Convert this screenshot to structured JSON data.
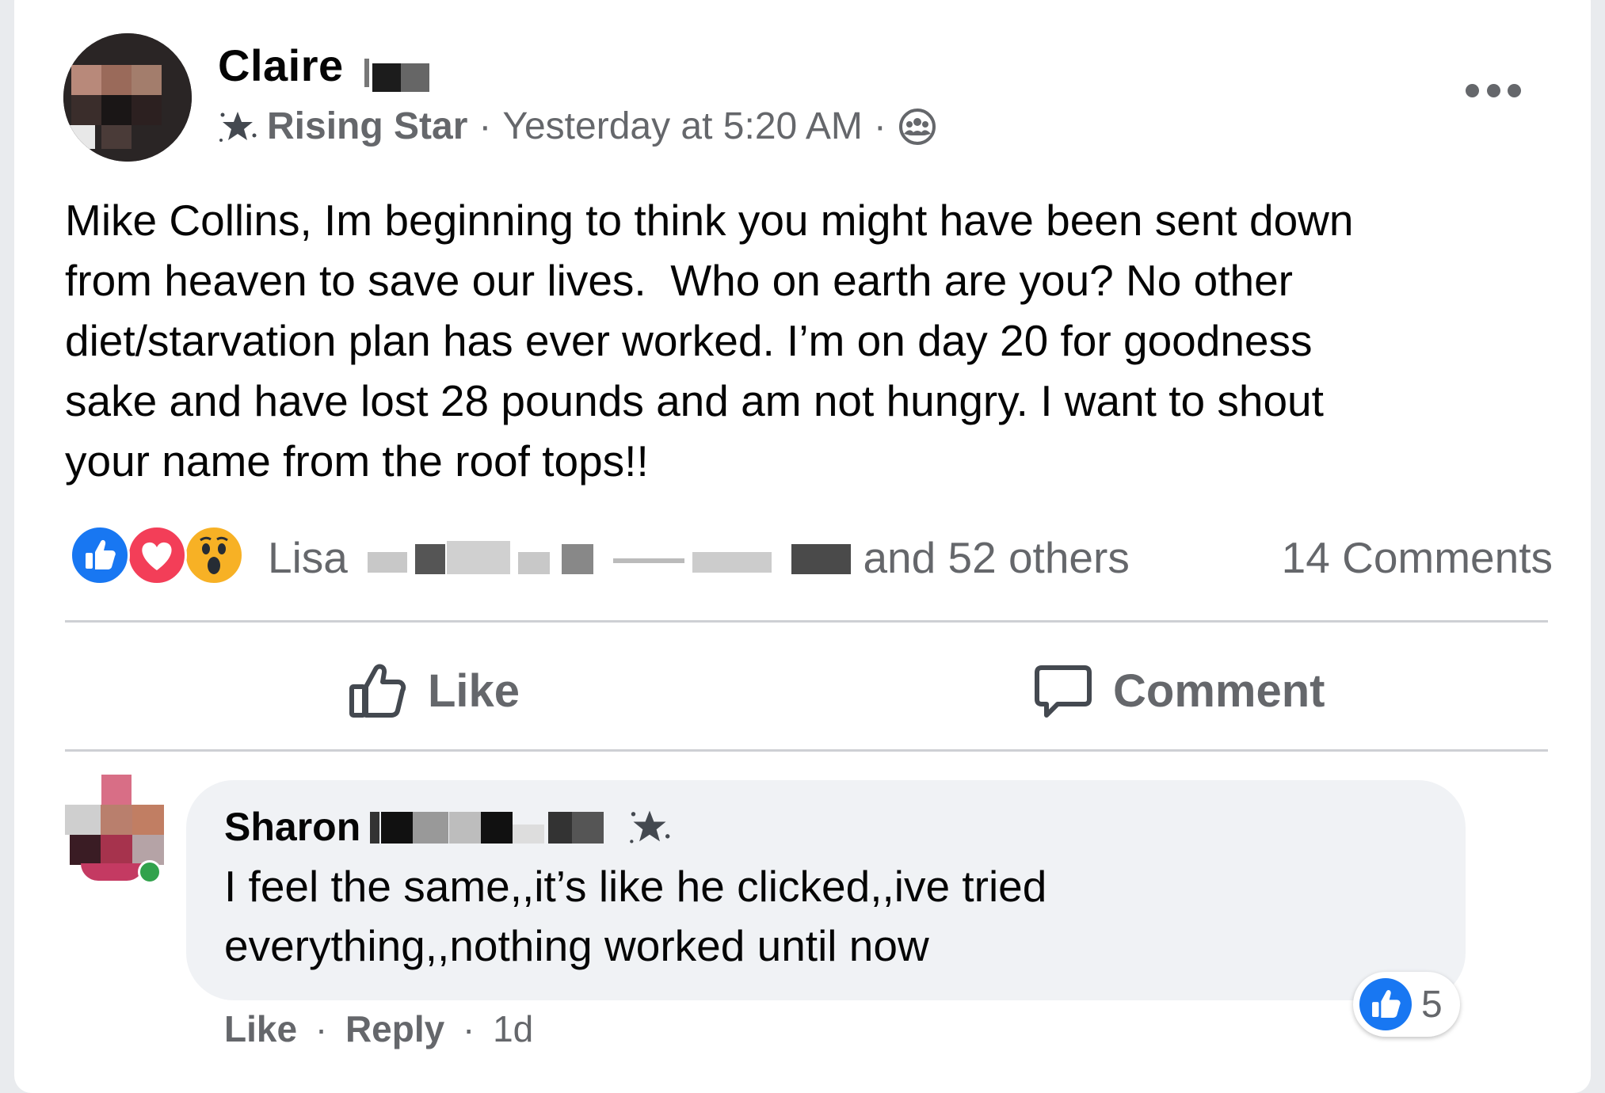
{
  "post": {
    "author": "Claire",
    "badge": "Rising Star",
    "separator": "·",
    "timestamp": "Yesterday at 5:20 AM",
    "privacy_icon": "group-icon",
    "more_icon": "more-options-icon",
    "text": "Mike Collins, Im beginning to think you might have been sent down\nfrom heaven to save our lives.  Who on earth are you? No other\ndiet/starvation plan has ever worked. I’m on day 20 for goodness\nsake and have lost 28 pounds and am not hungry. I want to shout\nyour name from the roof tops!!"
  },
  "reactions": {
    "icons": [
      "like-icon",
      "love-icon",
      "wow-icon"
    ],
    "first_name": "Lisa",
    "others": "and 52 others",
    "comments": "14 Comments"
  },
  "actions": {
    "like": "Like",
    "comment": "Comment"
  },
  "comment": {
    "author": "Sharon",
    "text": "I feel the same,,it’s like he clicked,,ive tried\neverything,,nothing worked until now",
    "like": "Like",
    "dot": "·",
    "reply": "Reply",
    "age": "1d",
    "reaction_count": "5"
  },
  "colors": {
    "like_blue": "#1877f2",
    "love_red": "#f33e58",
    "wow_yellow": "#f7b125",
    "secondary_text": "#65676b",
    "bubble_bg": "#f0f2f5"
  }
}
